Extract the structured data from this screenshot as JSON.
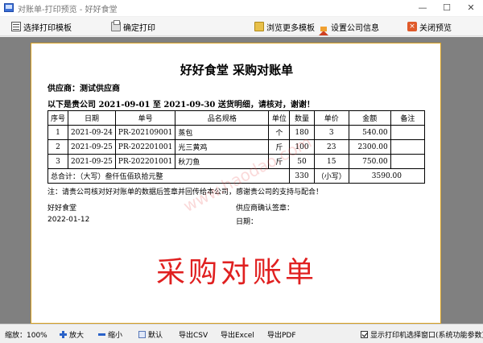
{
  "window": {
    "title": "对账单-打印预览 - 好好食堂",
    "minimize": "—",
    "maximize": "☐",
    "close": "✕"
  },
  "toolbar": {
    "select_template": "选择打印模板",
    "confirm_print": "确定打印",
    "browse_templates": "浏览更多模板",
    "company_info": "设置公司信息",
    "close_preview": "关闭预览"
  },
  "document": {
    "title": "好好食堂  采购对账单",
    "supplier": "供应商：测试供应商",
    "period": "以下是贵公司 2021-09-01 至 2021-09-30 送货明细，请核对，谢谢！",
    "columns": [
      "序号",
      "日期",
      "单号",
      "品名规格",
      "单位",
      "数量",
      "单价",
      "金额",
      "备注"
    ],
    "rows": [
      [
        "1",
        "2021-09-24",
        "PR-202109001",
        "蒸包",
        "个",
        "180",
        "3",
        "540.00",
        ""
      ],
      [
        "2",
        "2021-09-25",
        "PR-202201001",
        "光三黄鸡",
        "斤",
        "100",
        "23",
        "2300.00",
        ""
      ],
      [
        "3",
        "2021-09-25",
        "PR-202201001",
        "秋刀鱼",
        "斤",
        "50",
        "15",
        "750.00",
        ""
      ]
    ],
    "total_label": "总合计：（大写）叁仟伍佰玖拾元整",
    "total_qty": "330",
    "total_small_label": "（小写）",
    "total_amount": "3590.00",
    "note": "注：请贵公司核对好对账单的数据后签章并回传给本公司，感谢贵公司的支持与配合！",
    "company": "好好食堂",
    "date": "2022-01-12",
    "supplier_sign": "供应商确认签章：",
    "sign_date": "日期：",
    "stamp_text": "采购对账单",
    "watermark": "www.haodao.com"
  },
  "statusbar": {
    "zoom": "缩放：100%",
    "zoom_in": "放大",
    "zoom_out": "缩小",
    "default": "默认",
    "export_csv": "导出CSV",
    "export_excel": "导出Excel",
    "export_pdf": "导出PDF",
    "show_printer": "显示打印机选择窗口(系统功能参数)"
  }
}
